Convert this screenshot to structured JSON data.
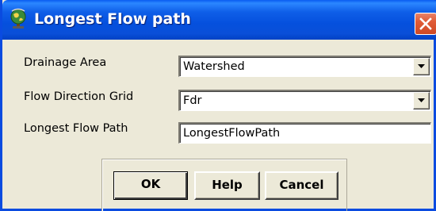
{
  "window": {
    "title": "Longest Flow path",
    "title_icon": "globe-icon",
    "close_icon": "close-icon"
  },
  "form": {
    "drainage_area": {
      "label": "Drainage Area",
      "value": "Watershed"
    },
    "flow_direction_grid": {
      "label": "Flow Direction Grid",
      "value": "Fdr"
    },
    "longest_flow_path": {
      "label": "Longest Flow Path",
      "value": "LongestFlowPath"
    }
  },
  "buttons": {
    "ok": "OK",
    "help": "Help",
    "cancel": "Cancel"
  },
  "colors": {
    "titlebar": "#0550dd",
    "window_bg": "#ece9d8",
    "close": "#e05a36"
  }
}
